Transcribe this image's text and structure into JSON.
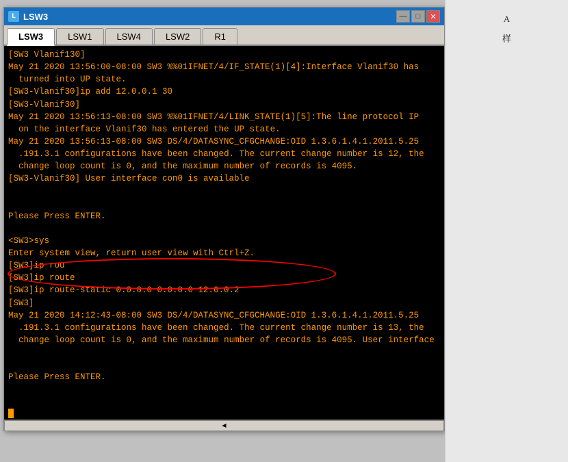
{
  "window": {
    "title": "LSW3",
    "icon_label": "L",
    "controls": [
      "—",
      "□",
      "✕"
    ]
  },
  "tabs": [
    {
      "label": "LSW3",
      "active": true
    },
    {
      "label": "LSW1",
      "active": false
    },
    {
      "label": "LSW4",
      "active": false
    },
    {
      "label": "LSW2",
      "active": false
    },
    {
      "label": "R1",
      "active": false
    }
  ],
  "terminal": {
    "lines": [
      "[SW3 Vlanif130]",
      "May 21 2020 13:56:00-08:00 SW3 %%01IFNET/4/IF_STATE(1)[4]:Interface Vlanif30 has",
      "  turned into UP state.",
      "[SW3-Vlanif30]ip add 12.0.0.1 30",
      "[SW3-Vlanif30]",
      "May 21 2020 13:56:13-08:00 SW3 %%01IFNET/4/LINK_STATE(1)[5]:The line protocol IP",
      "  on the interface Vlanif30 has entered the UP state.",
      "May 21 2020 13:56:13-08:00 SW3 DS/4/DATASYNC_CFGCHANGE:OID 1.3.6.1.4.1.2011.5.25",
      "  .191.3.1 configurations have been changed. The current change number is 12, the",
      "  change loop count is 0, and the maximum number of records is 4095.",
      "[SW3-Vlanif30] User interface con0 is available",
      "",
      "",
      "Please Press ENTER.",
      "",
      "<SW3>sys",
      "Enter system view, return user view with Ctrl+Z.",
      "[SW3]ip rou",
      "[SW3]ip route",
      "[SW3]ip route-static 0.0.0.0 0.0.0.0 12.0.0.2",
      "[SW3]",
      "May 21 2020 14:12:43-08:00 SW3 DS/4/DATASYNC_CFGCHANGE:OID 1.3.6.1.4.1.2011.5.25",
      "  .191.3.1 configurations have been changed. The current change number is 13, the",
      "  change loop count is 0, and the maximum number of records is 4095. User interface",
      "",
      "",
      "Please Press ENTER.",
      ""
    ]
  },
  "url": "https://blog.csdn.net/daxiong...",
  "right_panel": {
    "labels": [
      "A",
      "样"
    ]
  }
}
